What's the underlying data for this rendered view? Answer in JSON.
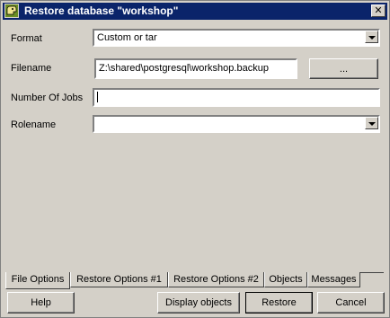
{
  "window": {
    "title": "Restore database \"workshop\"",
    "close_label": "✕"
  },
  "form": {
    "format_label": "Format",
    "format_value": "Custom or tar",
    "filename_label": "Filename",
    "filename_value": "Z:\\shared\\postgresql\\workshop.backup",
    "browse_label": "...",
    "jobs_label": "Number Of Jobs",
    "jobs_value": "",
    "rolename_label": "Rolename",
    "rolename_value": ""
  },
  "tabs": [
    {
      "label": "File Options"
    },
    {
      "label": "Restore Options #1"
    },
    {
      "label": "Restore Options #2"
    },
    {
      "label": "Objects"
    },
    {
      "label": "Messages"
    }
  ],
  "buttons": {
    "help": "Help",
    "display_objects": "Display objects",
    "restore": "Restore",
    "cancel": "Cancel"
  },
  "icons": {
    "app": "pgadmin-elephant-icon",
    "combo": "chevron-down-icon"
  }
}
